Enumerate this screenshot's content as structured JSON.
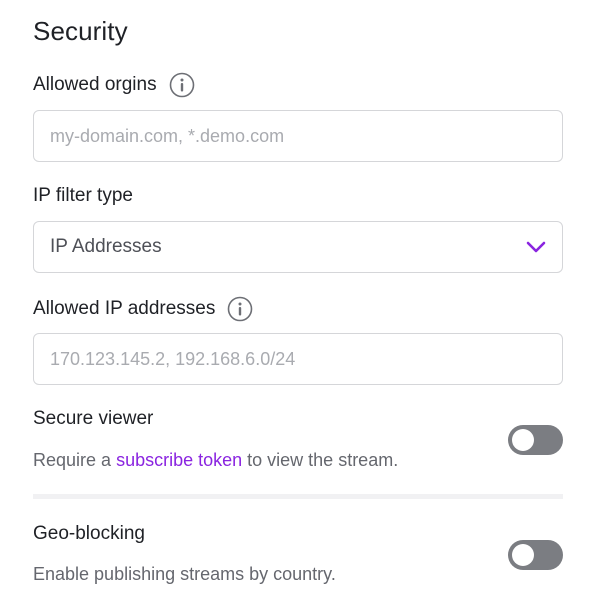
{
  "section": {
    "title": "Security"
  },
  "allowed_origins": {
    "label": "Allowed orgins",
    "placeholder": "my-domain.com, *.demo.com",
    "value": ""
  },
  "ip_filter_type": {
    "label": "IP filter type",
    "selected": "IP Addresses"
  },
  "allowed_ip_addresses": {
    "label": "Allowed IP addresses",
    "placeholder": "170.123.145.2, 192.168.6.0/24",
    "value": ""
  },
  "secure_viewer": {
    "title": "Secure viewer",
    "desc_prefix": "Require a ",
    "desc_link": "subscribe token",
    "desc_suffix": " to view the stream.",
    "enabled": false
  },
  "geo_blocking": {
    "title": "Geo-blocking",
    "desc": "Enable publishing streams by country.",
    "enabled": false
  },
  "colors": {
    "accent": "#8a24e0",
    "toggle_off": "#7b7d82",
    "border": "#d5d6d9"
  },
  "icons": {
    "info": "info-circle-icon",
    "chevron": "chevron-down-icon"
  }
}
